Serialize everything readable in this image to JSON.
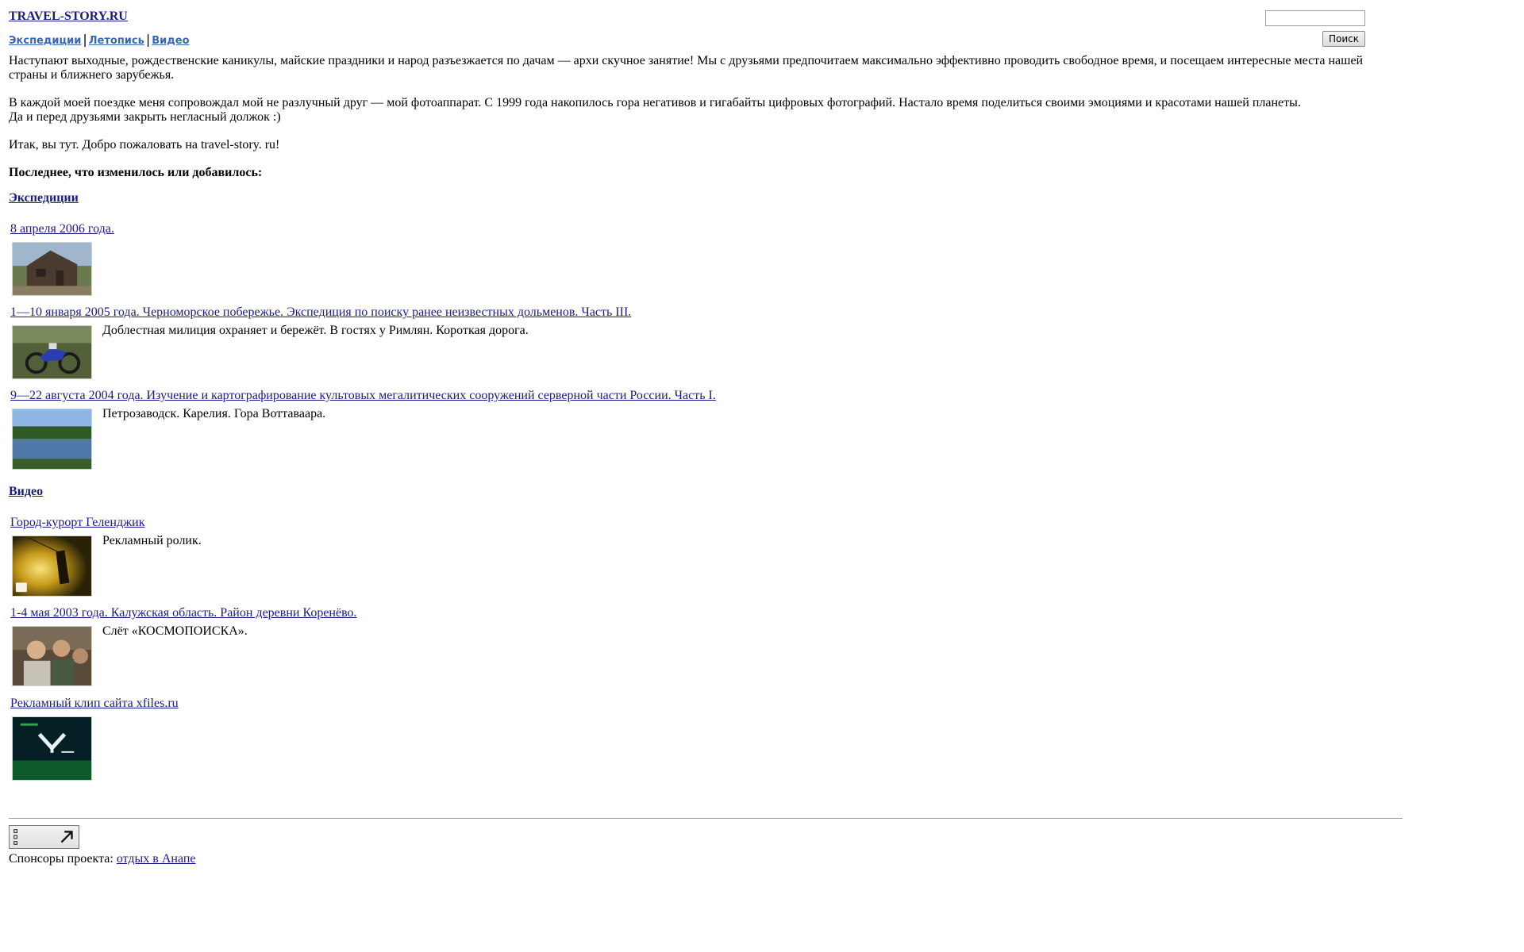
{
  "site": {
    "title": "TRAVEL-STORY.RU"
  },
  "nav": {
    "items": [
      "Экспедиции",
      "Летопись",
      "Видео"
    ],
    "separator": "|"
  },
  "search": {
    "placeholder": "",
    "button_label": "Поиск"
  },
  "intro": {
    "p1": "Наступают выходные, рождественские каникулы, майские праздники и народ разъезжается по дачам — архи скучное занятие! Мы с друзьями предпочитаем максимально эффективно проводить свободное время, и посещаем интересные места нашей страны и ближнего зарубежья.",
    "p2a": "В каждой моей поездке меня сопровождал мой не разлучный друг — мой фотоаппарат. С 1999 года накопилось гора негативов и гигабайты цифровых фотографий. Настало время поделиться своими эмоциями и красотами нашей планеты.",
    "p2b": "Да и перед друзьями закрыть негласный должок :)",
    "p3": "Итак, вы тут. Добро пожаловать на travel-story. ru!",
    "latest_heading": "Последнее, что изменилось или добавилось:"
  },
  "expeditions": {
    "section_label": "Экспедиции",
    "entries": [
      {
        "title": "8 апреля 2006 года.",
        "desc": ""
      },
      {
        "title": "1—10 января 2005 года. Черноморское побережье. Экспедиция по поиску ранее неизвестных дольменов. Часть III.",
        "desc": "Доблестная милиция охраняет и бережёт. В гостях у Римлян. Короткая дорога."
      },
      {
        "title": "9—22 августа 2004 года. Изучение и картографирование культовых мегалитических сооружений серверной части России. Часть I.",
        "desc": "Петрозаводск. Карелия. Гора Воттаваара."
      }
    ]
  },
  "video": {
    "section_label": "Видео",
    "entries": [
      {
        "title": "Город-курорт Геленджик",
        "desc": "Рекламный ролик."
      },
      {
        "title": "1-4 мая 2003 года. Калужская область. Район деревни Коренёво.",
        "desc": "Слёт «КОСМОПОИСКА»."
      },
      {
        "title": "Рекламный клип сайта xfiles.ru",
        "desc": ""
      }
    ]
  },
  "footer": {
    "sponsors_label": "Спонсоры проекта:",
    "sponsor_link": "отдых в Анапе"
  },
  "colors": {
    "link": "#1a1a8a",
    "nav_link": "#3a66b7"
  },
  "icons": {
    "counter": "external-link-arrow-icon"
  }
}
